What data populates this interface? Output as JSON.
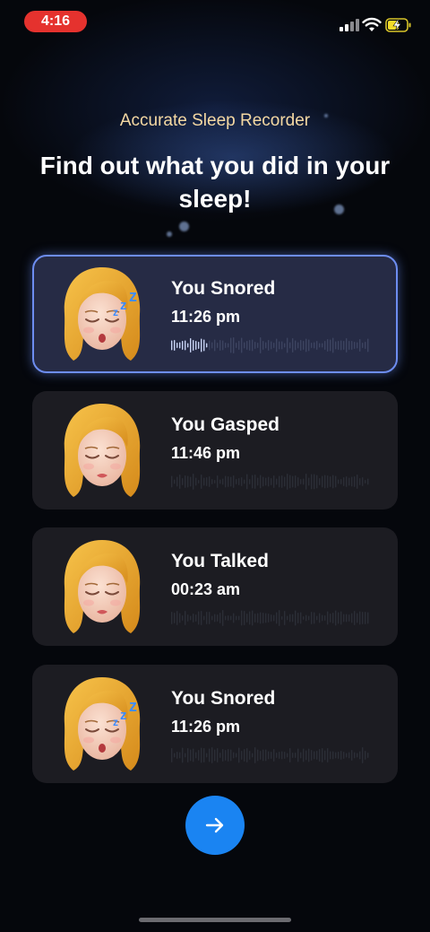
{
  "status_bar": {
    "time": "4:16"
  },
  "header": {
    "subtitle": "Accurate Sleep Recorder",
    "headline": "Find out what you did in your sleep!"
  },
  "cards": [
    {
      "title": "You Snored",
      "time": "11:26 pm",
      "selected": true,
      "avatar": "snoring-woman-avatar-icon"
    },
    {
      "title": "You Gasped",
      "time": "11:46 pm",
      "selected": false,
      "avatar": "sleeping-woman-avatar-icon"
    },
    {
      "title": "You Talked",
      "time": "00:23 am",
      "selected": false,
      "avatar": "sleeping-woman-avatar-icon"
    },
    {
      "title": "You Snored",
      "time": "11:26 pm",
      "selected": false,
      "avatar": "snoring-woman-avatar-icon"
    }
  ],
  "next_button": {
    "icon": "arrow-right-icon"
  },
  "colors": {
    "accent": "#1a84f2",
    "selected_border": "#6d8df0",
    "subtitle": "#f5d9a3",
    "time_pill": "#e5322e"
  }
}
